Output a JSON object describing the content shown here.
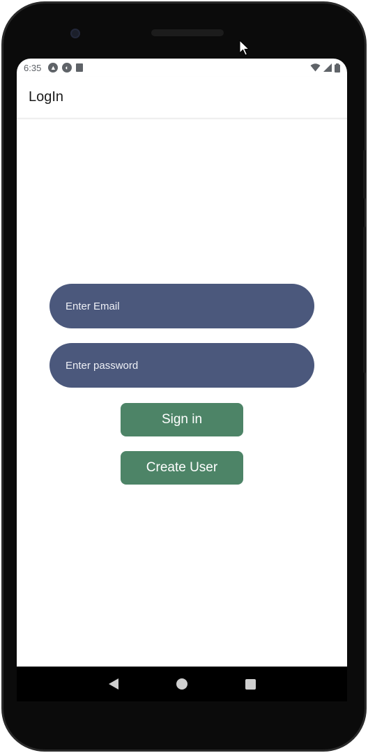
{
  "status": {
    "time": "6:35",
    "left_icons": [
      "android-studio-icon",
      "firebase-icon",
      "sd-card-icon"
    ],
    "right_icons": [
      "wifi-icon",
      "signal-icon",
      "battery-icon"
    ]
  },
  "appbar": {
    "title": "LogIn"
  },
  "form": {
    "email_placeholder": "Enter Email",
    "password_placeholder": "Enter password",
    "signin_label": "Sign in",
    "create_label": "Create User"
  },
  "nav": {
    "icons": [
      "back-icon",
      "home-icon",
      "recents-icon"
    ]
  },
  "colors": {
    "input_bg": "#4b587c",
    "button_bg": "#4d8467",
    "screen_bg": "#ffffff",
    "frame": "#0b0b0b"
  }
}
